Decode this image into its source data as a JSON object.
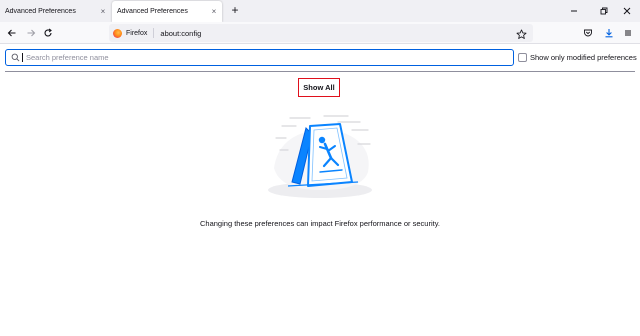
{
  "tabs": [
    {
      "label": "Advanced Preferences",
      "active": false
    },
    {
      "label": "Advanced Preferences",
      "active": true
    }
  ],
  "tab_close_glyph": "×",
  "new_tab_glyph": "+",
  "window_controls": [
    "minimize-icon",
    "restore-icon",
    "close-icon"
  ],
  "nav": {
    "back": "back-arrow-icon",
    "forward": "forward-arrow-icon",
    "reload": "reload-icon",
    "identity_label": "Firefox",
    "url": "about:config",
    "toolbar_icons": [
      "bookmark-star-icon",
      "pocket-icon",
      "downloads-icon",
      "menu-icon"
    ]
  },
  "search": {
    "placeholder": "Search preference name",
    "value": "",
    "show_modified_label": "Show only modified preferences",
    "show_modified_checked": false
  },
  "content": {
    "show_all_label": "Show All",
    "warning_text": "Changing these preferences can impact Firefox performance or security."
  },
  "colors": {
    "accent": "#0061e0",
    "highlight_box": "#e0101c",
    "illustration_blue": "#0a84ff"
  }
}
